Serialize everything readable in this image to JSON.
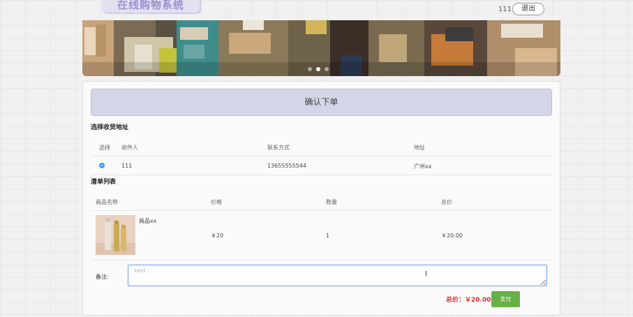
{
  "header": {
    "site_title": "在线购物系统",
    "user_name": "111",
    "logout_label": "退出"
  },
  "banner": {
    "slide_count": 3,
    "active_slide": 2
  },
  "order": {
    "confirm_label": "确认下单",
    "address_section_title": "选择收货地址",
    "address_headers": [
      "选择",
      "收件人",
      "联系方式",
      "地址"
    ],
    "addresses": [
      {
        "selected": true,
        "recipient": "111",
        "phone": "13655555544",
        "address": "广州xx"
      }
    ],
    "items_section_title": "清单列表",
    "item_headers": [
      "商品名称",
      "价格",
      "数量",
      "总价"
    ],
    "items": [
      {
        "name": "商品xx",
        "price": "￥20",
        "quantity": "1",
        "total": "￥20.00"
      }
    ],
    "note_label": "备注:",
    "note_value": "test",
    "total_label": "总价：",
    "total_value": "￥20.00",
    "pay_label": "支付"
  },
  "colors": {
    "accent": "#409eff",
    "pay_button": "#67b044",
    "total_text": "#d9302c",
    "confirm_bar": "#d5d5e8"
  }
}
